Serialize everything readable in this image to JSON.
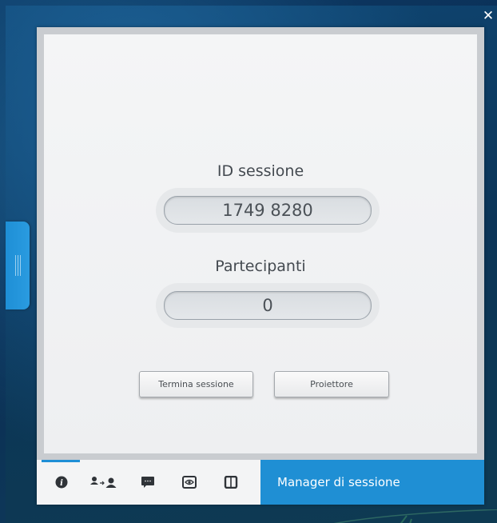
{
  "close_icon": "close-icon",
  "session": {
    "id_label": "ID sessione",
    "id_value": "1749 8280",
    "participants_label": "Partecipanti",
    "participants_value": "0"
  },
  "buttons": {
    "end_session": "Termina sessione",
    "projector": "Proiettore"
  },
  "bottom_bar": {
    "tabs": [
      {
        "icon": "info-icon",
        "active": true
      },
      {
        "icon": "participants-icon",
        "active": false
      },
      {
        "icon": "chat-icon",
        "active": false
      },
      {
        "icon": "eye-icon",
        "active": false
      },
      {
        "icon": "pause-icon",
        "active": false
      }
    ],
    "title": "Manager di sessione"
  },
  "colors": {
    "accent": "#1f8fd4",
    "panel_bg": "#f1f2f4",
    "text": "#444a50"
  }
}
